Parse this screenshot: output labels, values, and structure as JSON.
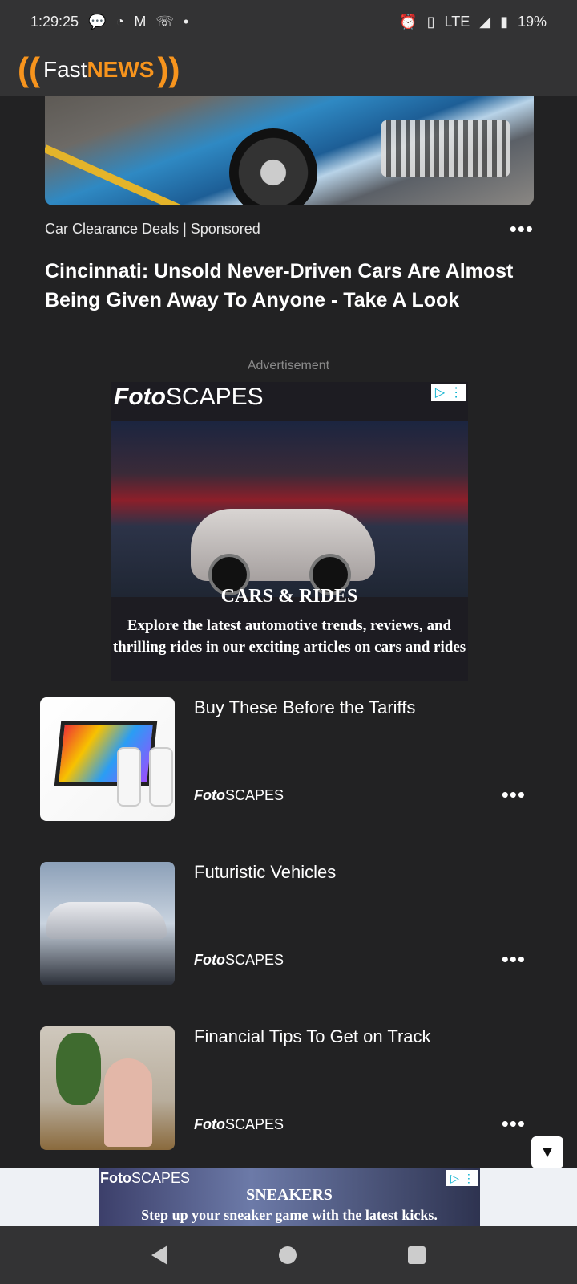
{
  "status_bar": {
    "time": "1:29:25",
    "network": "LTE",
    "battery": "19%"
  },
  "app": {
    "logo_left": "((",
    "logo_fast": "Fast",
    "logo_news": "NEWS",
    "logo_right": "))"
  },
  "sponsored_article": {
    "source": "Car Clearance Deals | Sponsored",
    "more": "•••",
    "headline": "Cincinnati: Unsold Never-Driven Cars Are Almost Being Given Away To Anyone - Take A Look"
  },
  "ad": {
    "label": "Advertisement",
    "brand_bold": "Foto",
    "brand_light": "SCAPES",
    "title": "CARS & RIDES",
    "description": "Explore the latest automotive trends, reviews, and thrilling rides in our exciting articles on cars and rides"
  },
  "articles": [
    {
      "title": "Buy These Before the Tariffs",
      "source_bold": "Foto",
      "source_light": "SCAPES",
      "more": "•••"
    },
    {
      "title": "Futuristic Vehicles",
      "source_bold": "Foto",
      "source_light": "SCAPES",
      "more": "•••"
    },
    {
      "title": "Financial Tips To Get on Track",
      "source_bold": "Foto",
      "source_light": "SCAPES",
      "more": "•••"
    }
  ],
  "scroll_button": "▼",
  "bottom_ad": {
    "brand_bold": "Foto",
    "brand_light": "SCAPES",
    "title": "SNEAKERS",
    "description": "Step up your sneaker game with the latest kicks."
  }
}
